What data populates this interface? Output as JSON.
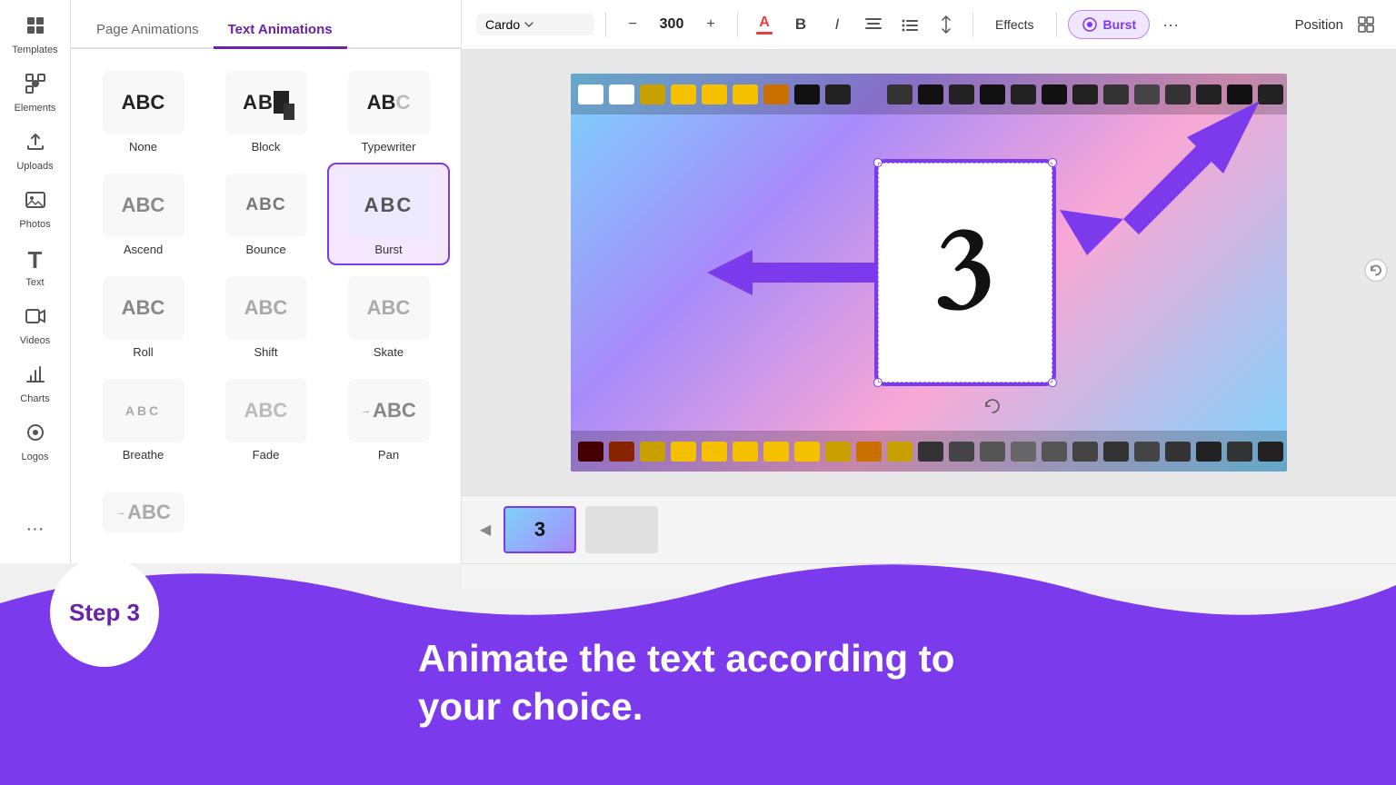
{
  "sidebar": {
    "items": [
      {
        "label": "Templates",
        "icon": "⊞"
      },
      {
        "label": "Elements",
        "icon": "✦"
      },
      {
        "label": "Uploads",
        "icon": "↑"
      },
      {
        "label": "Photos",
        "icon": "🖼"
      },
      {
        "label": "Text",
        "icon": "T"
      },
      {
        "label": "Videos",
        "icon": "▶"
      },
      {
        "label": "Charts",
        "icon": "📊"
      },
      {
        "label": "Logos",
        "icon": "◎"
      },
      {
        "label": "...",
        "icon": "···"
      }
    ]
  },
  "anim_panel": {
    "tab_page": "Page Animations",
    "tab_text": "Text Animations",
    "active_tab": "text",
    "items": [
      {
        "id": "none",
        "label": "None",
        "style": "none"
      },
      {
        "id": "block",
        "label": "Block",
        "style": "block"
      },
      {
        "id": "typewriter",
        "label": "Typewriter",
        "style": "typewriter"
      },
      {
        "id": "ascend",
        "label": "Ascend",
        "style": "ascend"
      },
      {
        "id": "bounce",
        "label": "Bounce",
        "style": "bounce"
      },
      {
        "id": "burst",
        "label": "Burst",
        "style": "burst",
        "selected": true
      },
      {
        "id": "roll",
        "label": "Roll",
        "style": "roll"
      },
      {
        "id": "shift",
        "label": "Shift",
        "style": "shift"
      },
      {
        "id": "skate",
        "label": "Skate",
        "style": "skate"
      },
      {
        "id": "breathe",
        "label": "Breathe",
        "style": "breathe"
      },
      {
        "id": "fade",
        "label": "Fade",
        "style": "fade"
      },
      {
        "id": "pan",
        "label": "Pan",
        "style": "pan"
      }
    ],
    "partial_items": [
      {
        "id": "rise",
        "label": "",
        "style": "rise"
      }
    ]
  },
  "toolbar": {
    "font_name": "Cardo",
    "font_size": "300",
    "font_size_decrease": "−",
    "font_size_increase": "+",
    "effects_label": "Effects",
    "burst_label": "Burst",
    "position_label": "Position",
    "color_icon": "A",
    "bold_icon": "B",
    "italic_icon": "I",
    "align_icon": "≡",
    "list_icon": "☰",
    "spacing_icon": "↕"
  },
  "canvas": {
    "number": "3"
  },
  "timeline": {
    "slide1_num": "3",
    "slide2_placeholder": ""
  },
  "bottom": {
    "step_label": "Step 3",
    "description_line1": "Animate the text according to",
    "description_line2": "your choice."
  }
}
